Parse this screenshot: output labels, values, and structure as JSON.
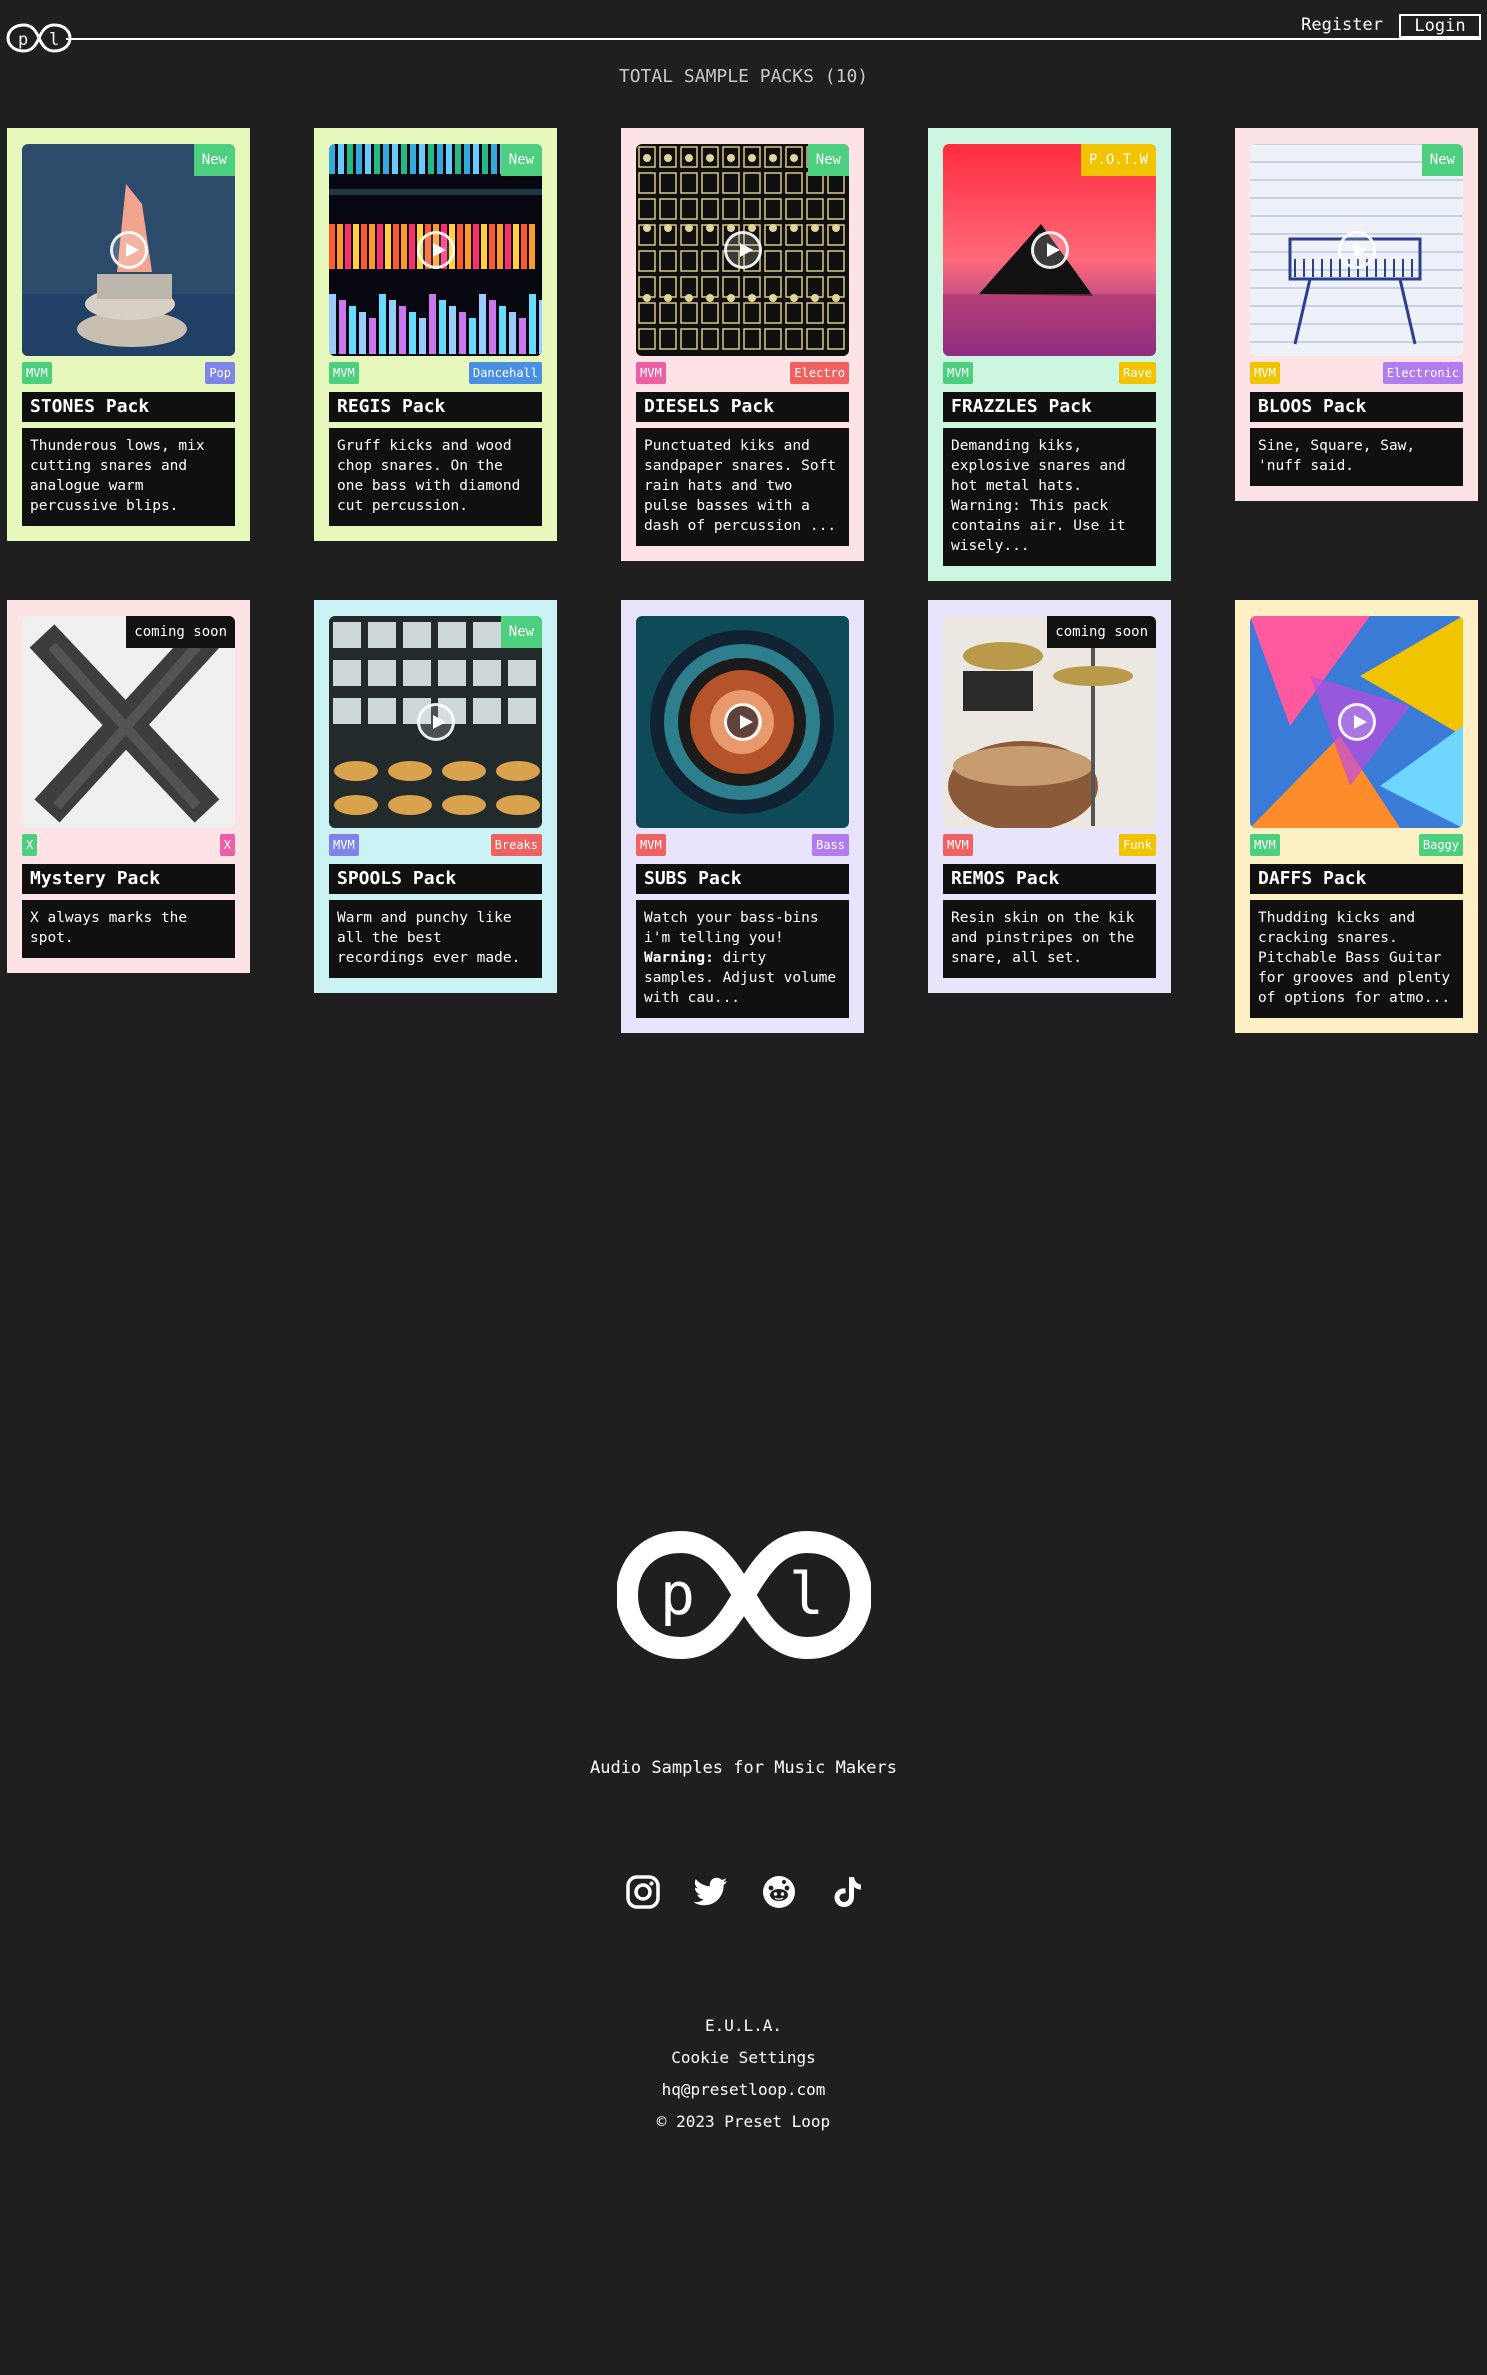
{
  "header": {
    "logo_text": "pl",
    "register_label": "Register",
    "login_label": "Login"
  },
  "summary": {
    "title": "TOTAL SAMPLE PACKS (10)"
  },
  "colors": {
    "green": "#4ccf7e",
    "yellow": "#f2c400",
    "blue": "#7d86e8",
    "pink": "#ec5fa4",
    "red": "#f06262",
    "sky": "#4a90e2",
    "purple": "#b07cf0"
  },
  "cards": [
    {
      "title": "STONES Pack",
      "description": "Thunderous lows, mix cutting snares and analogue warm percussive blips.",
      "badge": "New",
      "tag_left": "MVM",
      "tag_right": "Pop",
      "bg": "#e7f8bd",
      "badge_color": "#4ccf7e",
      "tag_left_color": "#4ccf7e",
      "tag_right_color": "#7d86e8",
      "image": "stones"
    },
    {
      "title": "REGIS Pack",
      "description": "Gruff kicks and wood chop snares. On the one bass with diamond cut percussion.",
      "badge": "New",
      "tag_left": "MVM",
      "tag_right": "Dancehall",
      "bg": "#e7f8bd",
      "badge_color": "#4ccf7e",
      "tag_left_color": "#4ccf7e",
      "tag_right_color": "#4a90e2",
      "image": "regis"
    },
    {
      "title": "DIESELS Pack",
      "description": "Punctuated kiks and sandpaper snares. Soft rain hats and two pulse basses with a dash of percussion ...",
      "badge": "New",
      "tag_left": "MVM",
      "tag_right": "Electro",
      "bg": "#fde2e6",
      "badge_color": "#4ccf7e",
      "tag_left_color": "#ec5fa4",
      "tag_right_color": "#f06262",
      "image": "diesels"
    },
    {
      "title": "FRAZZLES Pack",
      "description": "Demanding kiks, explosive snares and hot metal hats. Warning: This pack contains air. Use it wisely...",
      "badge": "P.O.T.W",
      "tag_left": "MVM",
      "tag_right": "Rave",
      "bg": "#cdf6e1",
      "badge_color": "#f2c400",
      "tag_left_color": "#4ccf7e",
      "tag_right_color": "#f2c400",
      "image": "frazzles"
    },
    {
      "title": "BLOOS Pack",
      "description": "Sine, Square, Saw, 'nuff said.",
      "badge": "New",
      "tag_left": "MVM",
      "tag_right": "Electronic",
      "bg": "#fde2e6",
      "badge_color": "#4ccf7e",
      "tag_left_color": "#f2c400",
      "tag_right_color": "#b07cf0",
      "image": "bloos"
    },
    {
      "title": "Mystery Pack",
      "description": "X always marks the spot.",
      "badge": "coming soon",
      "tag_left": "X",
      "tag_right": "X",
      "bg": "#fde2e6",
      "badge_color": "#111111",
      "tag_left_color": "#4ccf7e",
      "tag_right_color": "#ec5fa4",
      "image": "mystery"
    },
    {
      "title": "SPOOLS Pack",
      "description": "Warm and punchy like all the best recordings ever made.",
      "badge": "New",
      "tag_left": "MVM",
      "tag_right": "Breaks",
      "bg": "#cbf3f5",
      "badge_color": "#4ccf7e",
      "tag_left_color": "#7d86e8",
      "tag_right_color": "#f06262",
      "image": "spools"
    },
    {
      "title": "SUBS Pack",
      "description_html": "Watch your bass-bins i'm telling you! <b>Warning:</b> dirty samples. Adjust volume with cau...",
      "description": "Watch your bass-bins i'm telling you! Warning: dirty samples. Adjust volume with cau...",
      "badge": "",
      "tag_left": "MVM",
      "tag_right": "Bass",
      "bg": "#e8e4fb",
      "badge_color": "#4ccf7e",
      "tag_left_color": "#f06262",
      "tag_right_color": "#b07cf0",
      "image": "subs"
    },
    {
      "title": "REMOS Pack",
      "description": "Resin skin on the kik and pinstripes on the snare, all set.",
      "badge": "coming soon",
      "tag_left": "MVM",
      "tag_right": "Funk",
      "bg": "#e8e4fb",
      "badge_color": "#111111",
      "tag_left_color": "#f06262",
      "tag_right_color": "#f2c400",
      "image": "remos"
    },
    {
      "title": "DAFFS Pack",
      "description": "Thudding kicks and cracking snares. Pitchable Bass Guitar for grooves and plenty of options for atmo...",
      "badge": "",
      "tag_left": "MVM",
      "tag_right": "Baggy",
      "bg": "#fdf0c4",
      "badge_color": "#4ccf7e",
      "tag_left_color": "#4ccf7e",
      "tag_right_color": "#4ccf7e",
      "image": "daffs"
    }
  ],
  "footer": {
    "tagline": "Audio Samples for Music Makers",
    "socials": [
      "instagram-icon",
      "twitter-icon",
      "reddit-icon",
      "tiktok-icon"
    ],
    "eula": "E.U.L.A.",
    "cookie": "Cookie Settings",
    "email": "hq@presetloop.com",
    "copyright": "© 2023 Preset Loop"
  }
}
